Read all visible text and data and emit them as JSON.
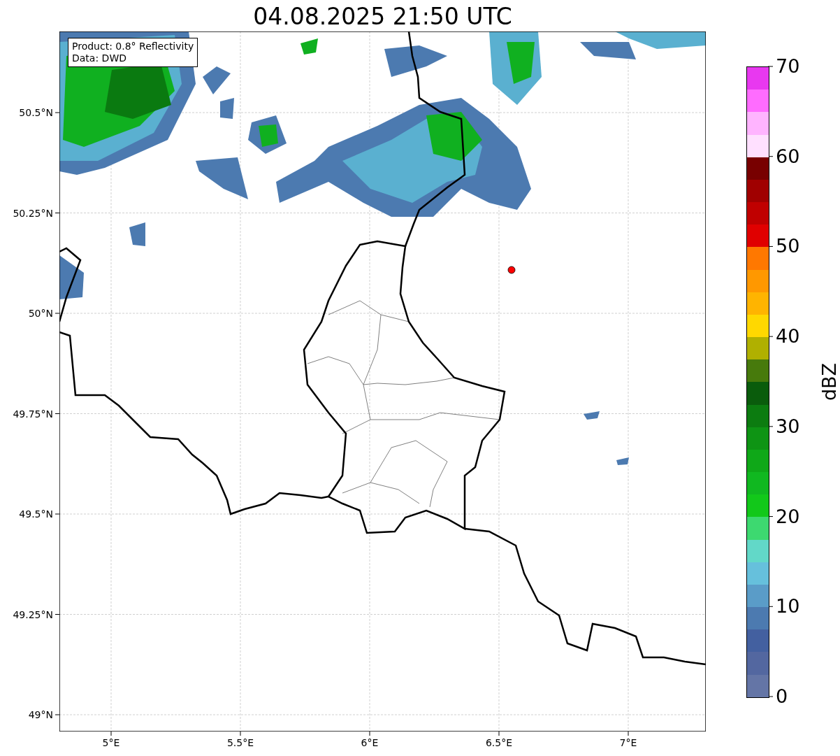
{
  "title": "04.08.2025 21:50 UTC",
  "info_box": {
    "lines": [
      "Product: 0.8° Reflectivity",
      "Data: DWD"
    ]
  },
  "map": {
    "x_ticks": [
      "5°E",
      "5.5°E",
      "6°E",
      "6.5°E",
      "7°E"
    ],
    "y_ticks": [
      "50.5°N",
      "50.25°N",
      "50°N",
      "49.75°N",
      "49.5°N",
      "49.25°N",
      "49°N"
    ]
  },
  "colorbar": {
    "label": "dBZ",
    "ticks": [
      "70",
      "60",
      "50",
      "40",
      "30",
      "20",
      "10",
      "0"
    ],
    "segments": [
      {
        "color": "#e838f0"
      },
      {
        "color": "#ff6cff"
      },
      {
        "color": "#ffb4ff"
      },
      {
        "color": "#ffe0ff"
      },
      {
        "color": "#780000"
      },
      {
        "color": "#a00000"
      },
      {
        "color": "#c00000"
      },
      {
        "color": "#e00000"
      },
      {
        "color": "#ff7800"
      },
      {
        "color": "#ff9800"
      },
      {
        "color": "#ffb400"
      },
      {
        "color": "#ffd800"
      },
      {
        "color": "#b0b000"
      },
      {
        "color": "#477a0c"
      },
      {
        "color": "#0a5c0c"
      },
      {
        "color": "#0c7c10"
      },
      {
        "color": "#0e9414"
      },
      {
        "color": "#0fa818"
      },
      {
        "color": "#10b820"
      },
      {
        "color": "#12c81a"
      },
      {
        "color": "#3dd970"
      },
      {
        "color": "#62d8c8"
      },
      {
        "color": "#66c0dc"
      },
      {
        "color": "#5a9cc8"
      },
      {
        "color": "#4c7ab0"
      },
      {
        "color": "#4360a0"
      },
      {
        "color": "#5367a0"
      },
      {
        "color": "#6475a6"
      }
    ]
  }
}
